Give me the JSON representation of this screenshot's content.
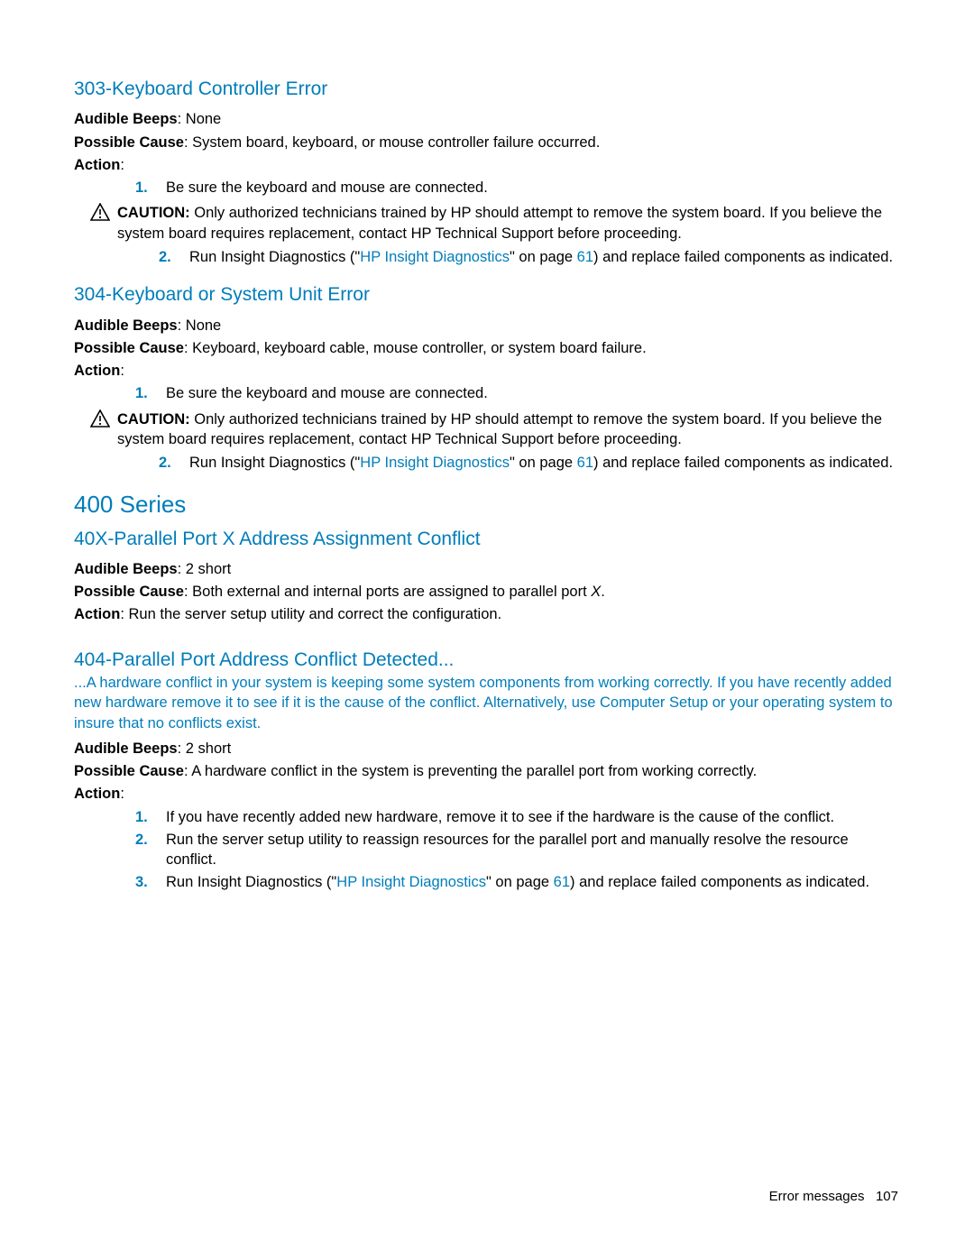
{
  "sec303": {
    "title": "303-Keyboard Controller Error",
    "beeps_label": "Audible Beeps",
    "beeps_value": ": None",
    "cause_label": "Possible Cause",
    "cause_value": ": System board, keyboard, or mouse controller failure occurred.",
    "action_label": "Action",
    "action_colon": ":",
    "step1": "Be sure the keyboard and mouse are connected.",
    "caution_label": "CAUTION:",
    "caution_body": "  Only authorized technicians trained by HP should attempt to remove the system board. If you believe the system board requires replacement, contact HP Technical Support before proceeding.",
    "step2_pre": "Run Insight Diagnostics (\"",
    "step2_link": "HP Insight Diagnostics",
    "step2_mid": "\" on page ",
    "step2_page": "61",
    "step2_post": ") and replace failed components as indicated."
  },
  "sec304": {
    "title": "304-Keyboard or System Unit Error",
    "beeps_label": "Audible Beeps",
    "beeps_value": ": None",
    "cause_label": "Possible Cause",
    "cause_value": ": Keyboard, keyboard cable, mouse controller, or system board failure.",
    "action_label": "Action",
    "action_colon": ":",
    "step1": "Be sure the keyboard and mouse are connected.",
    "caution_label": "CAUTION:",
    "caution_body": "  Only authorized technicians trained by HP should attempt to remove the system board. If you believe the system board requires replacement, contact HP Technical Support before proceeding.",
    "step2_pre": "Run Insight Diagnostics (\"",
    "step2_link": "HP Insight Diagnostics",
    "step2_mid": "\" on page ",
    "step2_page": "61",
    "step2_post": ") and replace failed components as indicated."
  },
  "series400": {
    "title": "400 Series"
  },
  "sec40x": {
    "title": "40X-Parallel Port X Address Assignment Conflict",
    "beeps_label": "Audible Beeps",
    "beeps_value": ": 2 short",
    "cause_label": "Possible Cause",
    "cause_pre": ": Both external and internal ports are assigned to parallel port ",
    "cause_var": "X",
    "cause_post": ".",
    "action_label": "Action",
    "action_value": ": Run the server setup utility and correct the configuration."
  },
  "sec404": {
    "title": "404-Parallel Port Address Conflict Detected...",
    "desc": "...A hardware conflict in your system is keeping some system components from working correctly. If you have recently added new hardware remove it to see if it is the cause of the conflict. Alternatively, use Computer Setup or your operating system to insure that no conflicts exist.",
    "beeps_label": "Audible Beeps",
    "beeps_value": ": 2 short",
    "cause_label": "Possible Cause",
    "cause_value": ": A hardware conflict in the system is preventing the parallel port from working correctly.",
    "action_label": "Action",
    "action_colon": ":",
    "step1": "If you have recently added new hardware, remove it to see if the hardware is the cause of the conflict.",
    "step2": "Run the server setup utility to reassign resources for the parallel port and manually resolve the resource conflict.",
    "step3_pre": "Run Insight Diagnostics (\"",
    "step3_link": "HP Insight Diagnostics",
    "step3_mid": "\" on page ",
    "step3_page": "61",
    "step3_post": ") and replace failed components as indicated."
  },
  "footer": {
    "label": "Error messages",
    "page": "107"
  },
  "nums": {
    "n1": "1.",
    "n2": "2.",
    "n3": "3."
  }
}
